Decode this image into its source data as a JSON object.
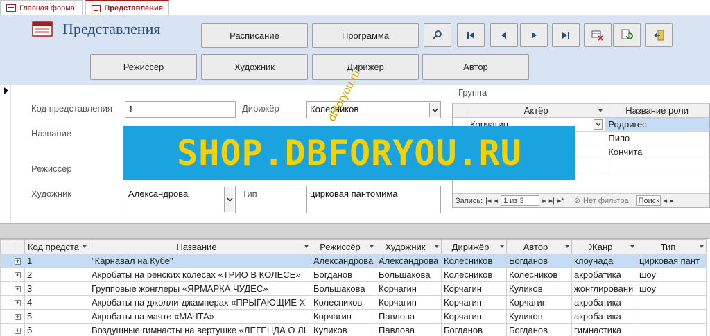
{
  "tabs": [
    {
      "label": "Главная форма"
    },
    {
      "label": "Представления"
    }
  ],
  "header": {
    "title": "Представления"
  },
  "buttons": {
    "schedule": "Расписание",
    "program": "Программа",
    "director": "Режиссёр",
    "artist": "Художник",
    "conductor": "Дирижёр",
    "author": "Автор"
  },
  "icons": {
    "search": "search-icon",
    "first": "first-record-icon",
    "prev": "previous-record-icon",
    "next": "next-record-icon",
    "last": "last-record-icon",
    "delete": "delete-record-icon",
    "refresh": "refresh-icon",
    "exit": "exit-icon"
  },
  "form": {
    "code_label": "Код представления",
    "code_value": "1",
    "name_label": "Название",
    "name_value": "",
    "director_label": "Режиссёр",
    "director_value": "",
    "artist_label": "Художник",
    "artist_value": "Александрова",
    "conductor_label": "Дирижёр",
    "conductor_value": "Колесников",
    "type_label": "Тип",
    "type_value": "цирковая пантомима",
    "group_label": "Группа"
  },
  "subform": {
    "headers": [
      "Актёр",
      "Название роли"
    ],
    "rows": [
      [
        "Корчагин",
        "Родригес"
      ],
      [
        "",
        "Пипо"
      ],
      [
        "",
        "Кончита"
      ],
      [
        "",
        ""
      ]
    ],
    "nav": {
      "label": "Запись:",
      "position": "1 из 3",
      "filter": "Нет фильтра",
      "search": "Поиск"
    }
  },
  "grid": {
    "headers": [
      "Код предста",
      "Название",
      "Режиссёр",
      "Художник",
      "Дирижёр",
      "Автор",
      "Жанр",
      "Тип"
    ],
    "rows": [
      [
        "1",
        "\"Карнавал на Кубе\"",
        "Александрова",
        "Александрова",
        "Колесников",
        "Богданов",
        "клоунада",
        "цирковая пант"
      ],
      [
        "2",
        "Акробаты на ренских колесах «ТРИО В КОЛЕСЕ»",
        "Богданов",
        "Большакова",
        "Колесников",
        "Колесников",
        "акробатика",
        "шоу"
      ],
      [
        "3",
        "Групповые жонглеры «ЯРМАРКА ЧУДЕС»",
        "Большакова",
        "Корчагин",
        "Корчагин",
        "Куликов",
        "жонглировани",
        "шоу"
      ],
      [
        "4",
        "Акробаты на джолли-джамперах «ПРЫГАЮЩИЕ Х",
        "Колесников",
        "Корчагин",
        "Корчагин",
        "Корчагин",
        "акробатика",
        ""
      ],
      [
        "5",
        "Акробаты на мачте «МАЧТА»",
        "Корчагин",
        "Павлова",
        "Корчагин",
        "Куликов",
        "акробатика",
        ""
      ],
      [
        "6",
        "Воздушные гимнасты на вертушке «ЛЕГЕНДА О ЛІ",
        "Куликов",
        "Павлова",
        "Богданов",
        "Богданов",
        "гимнастика",
        ""
      ]
    ]
  },
  "watermark": {
    "main": "SHOP.DBFORYOU.RU",
    "diag": "dbforyou.ru"
  },
  "colors": {
    "accent": "#a32020",
    "header_bg": "#d8e4f3",
    "selected_row": "#c5dcf5",
    "watermark_bg": "#1aa3de",
    "watermark_text": "#f5d100"
  }
}
